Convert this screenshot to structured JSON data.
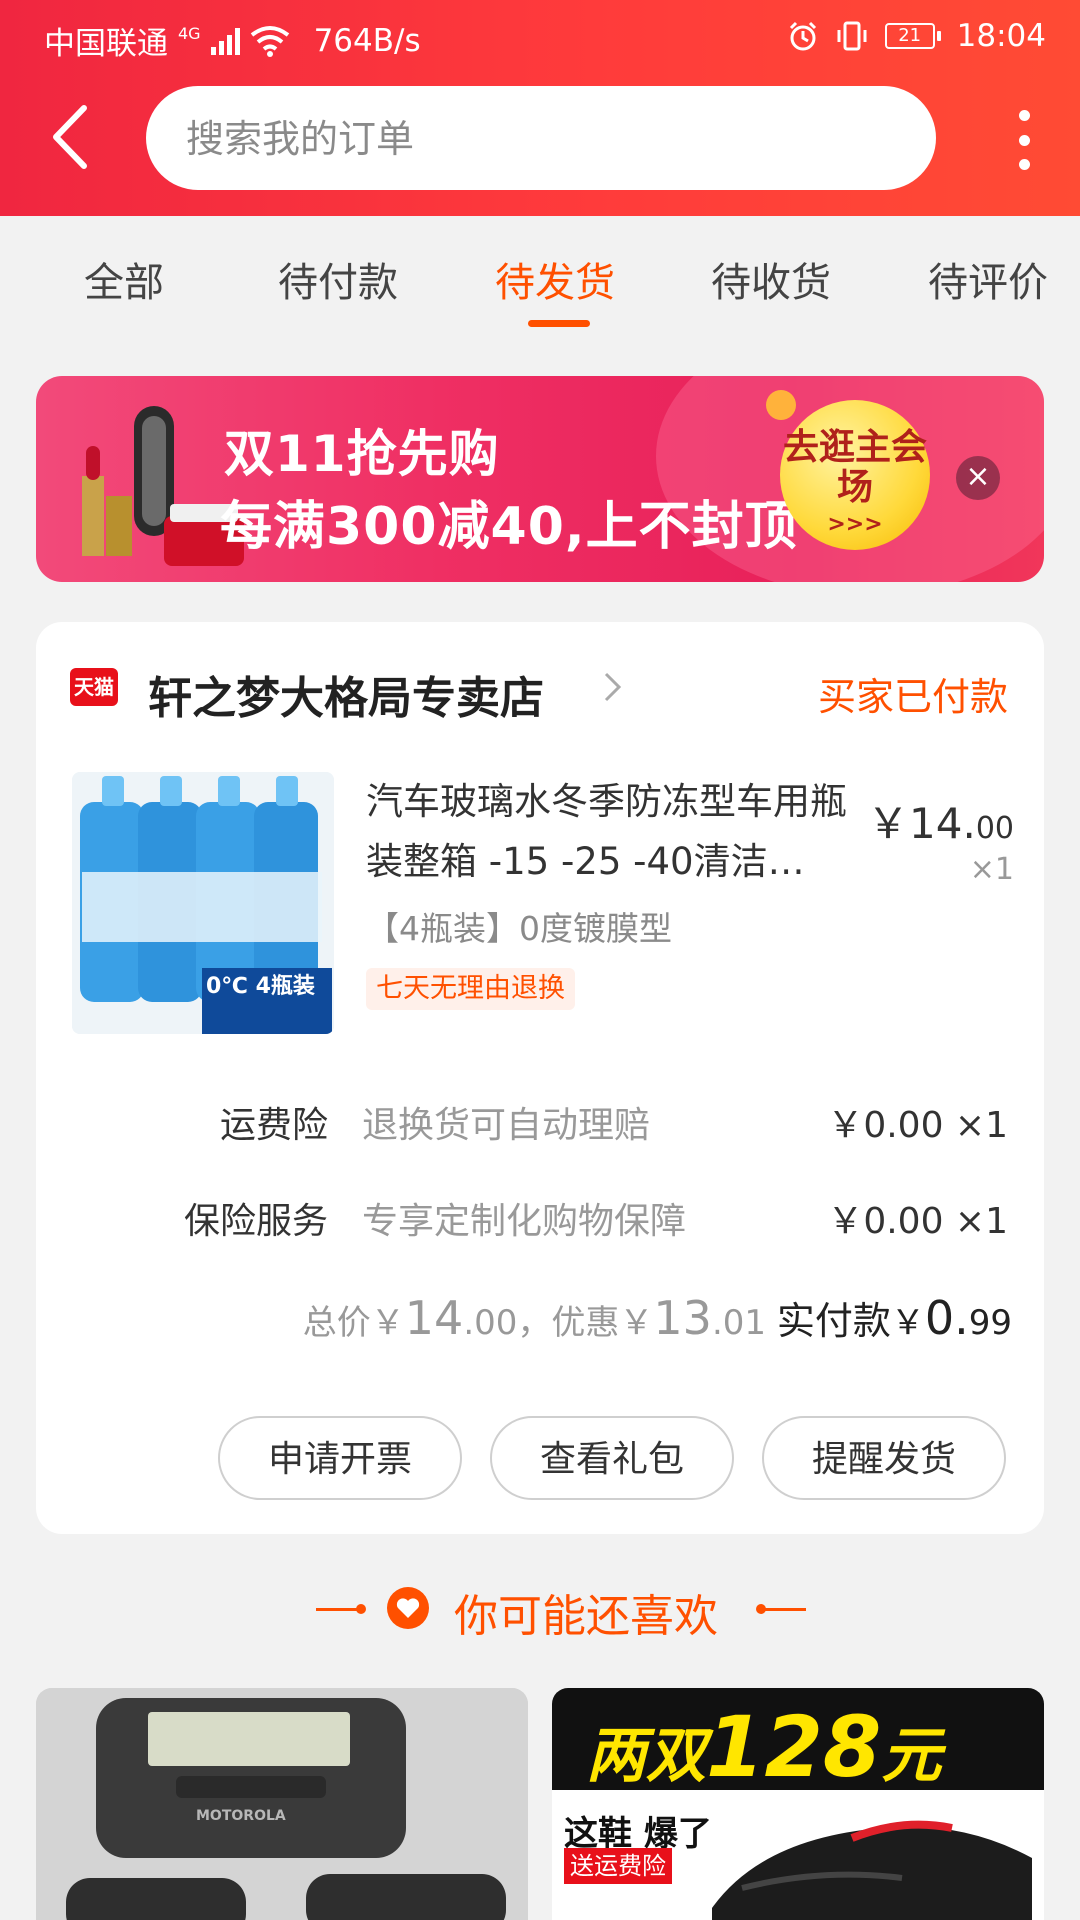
{
  "status_bar": {
    "carrier": "中国联通",
    "network": "4G",
    "speed": "764B/s",
    "battery": "21",
    "time": "18:04"
  },
  "search": {
    "placeholder": "搜索我的订单"
  },
  "tabs": [
    {
      "label": "全部"
    },
    {
      "label": "待付款"
    },
    {
      "label": "待发货",
      "active": true
    },
    {
      "label": "待收货"
    },
    {
      "label": "待评价"
    }
  ],
  "banner": {
    "title": "双11抢先购",
    "subtitle": "每满300减40,上不封顶",
    "cta": "去逛主会场",
    "cta_arrows": ">>>",
    "close": "×"
  },
  "order": {
    "platform_badge": "天猫",
    "shop_name": "轩之梦大格局专卖店",
    "status": "买家已付款",
    "item": {
      "title": "汽车玻璃水冬季防冻型车用瓶装整箱 -15 -25 -40清洁…",
      "sku": "【4瓶装】0度镀膜型",
      "tag": "七天无理由退换",
      "price_main": "￥14.",
      "price_cents": "00",
      "qty": "×1",
      "thumb_text": "0℃ 4瓶装"
    },
    "services": [
      {
        "label": "运费险",
        "desc": "退换货可自动理赔",
        "value": "￥0.00 ×1"
      },
      {
        "label": "保险服务",
        "desc": "专享定制化购物保障",
        "value": "￥0.00 ×1"
      }
    ],
    "total": {
      "total_label": "总价",
      "total_yen": "￥",
      "total_int": "14",
      "total_dec": ".00",
      "discount_label": "，优惠",
      "discount_yen": "￥",
      "discount_int": "13",
      "discount_dec": ".01",
      "paid_label": "实付款",
      "paid_yen": "￥",
      "paid_int": "0.",
      "paid_dec": "99"
    },
    "buttons": [
      "申请开票",
      "查看礼包",
      "提醒发货"
    ]
  },
  "recommend": {
    "title": "你可能还喜欢",
    "items": [
      {
        "brand_text": "MOTOROLA"
      },
      {
        "headline_a": "两双",
        "headline_num": "128",
        "headline_b": "元",
        "line2": "这鞋 爆了",
        "line3": "送运费险"
      }
    ]
  },
  "colors": {
    "accent": "#ff5000",
    "header": "#f02640"
  }
}
